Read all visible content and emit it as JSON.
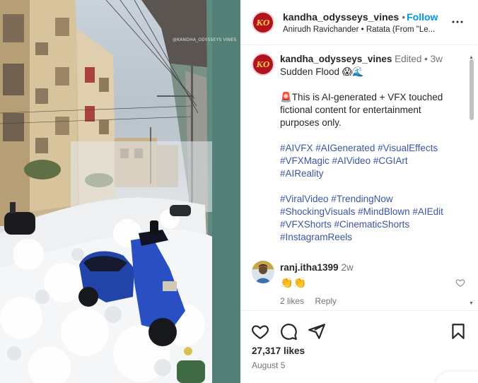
{
  "media": {
    "watermark": "@KANDHA_ODYSSEYS VINES",
    "scene": "flooded-street-foam"
  },
  "header": {
    "username": "kandha_odysseys_vines",
    "separator": "•",
    "follow_label": "Follow",
    "audio": "Anirudh Ravichander • Ratata (From \"Le...",
    "avatar_initials": "KO",
    "more_icon": "more-horizontal-icon"
  },
  "caption": {
    "username": "kandha_odysseys_vines",
    "edited": "Edited",
    "separator": "•",
    "time": "3w",
    "title": "Sudden Flood 😱🌊",
    "disclaimer_1": "🚨This is AI-generated + VFX touched",
    "disclaimer_2": "fictional content for entertainment",
    "disclaimer_3": "purposes only.",
    "tags_1": "#AIVFX #AIGenerated #VisualEffects",
    "tags_2": "#VFXMagic #AIVideo #CGIArt",
    "tags_3": "#AIReality",
    "tags_4": "#ViralVideo #TrendingNow",
    "tags_5": "#ShockingVisuals #MindBlown #AIEdit",
    "tags_6": "#VFXShorts #CinematicShorts",
    "tags_7": "#InstagramReels"
  },
  "comment": {
    "username": "ranj.itha1399",
    "time": "2w",
    "text": "👏👏",
    "likes": "2 likes",
    "reply_label": "Reply"
  },
  "actions": {
    "likes": "27,317 likes",
    "date": "August 5",
    "icons": [
      "heart-icon",
      "comment-icon",
      "share-icon",
      "bookmark-icon"
    ]
  },
  "colors": {
    "follow": "#0095f6",
    "hashtag": "#3b56a4",
    "secondary_text": "#737373",
    "brand_avatar": "#b3121f"
  }
}
